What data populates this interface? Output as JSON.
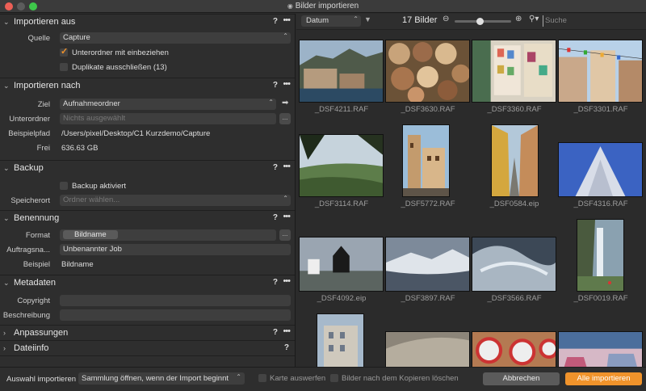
{
  "window": {
    "title": "Bilder importieren"
  },
  "sections": {
    "import_from": {
      "title": "Importieren aus",
      "source_label": "Quelle",
      "source_value": "Capture",
      "include_subfolders_label": "Unterordner mit einbeziehen",
      "include_subfolders_checked": true,
      "exclude_duplicates_label": "Duplikate ausschließen (13)",
      "exclude_duplicates_checked": false
    },
    "import_to": {
      "title": "Importieren nach",
      "target_label": "Ziel",
      "target_value": "Aufnahmeordner",
      "subfolder_label": "Unterordner",
      "subfolder_placeholder": "Nichts ausgewählt",
      "sample_path_label": "Beispielpfad",
      "sample_path_value": "/Users/pixel/Desktop/C1 Kurzdemo/Capture",
      "free_label": "Frei",
      "free_value": "636.63 GB"
    },
    "backup": {
      "title": "Backup",
      "backup_enabled_label": "Backup aktiviert",
      "location_label": "Speicherort",
      "location_placeholder": "Ordner wählen..."
    },
    "naming": {
      "title": "Benennung",
      "format_label": "Format",
      "format_token": "Bildname",
      "job_label": "Auftragsna...",
      "job_value": "Unbenannter Job",
      "example_label": "Beispiel",
      "example_value": "Bildname"
    },
    "metadata": {
      "title": "Metadaten",
      "copyright_label": "Copyright",
      "copyright_value": "",
      "description_label": "Beschreibung",
      "description_value": ""
    },
    "adjustments": {
      "title": "Anpassungen"
    },
    "file_info": {
      "title": "Dateiinfo"
    }
  },
  "common": {
    "help": "?",
    "more": "•••",
    "browse": "...",
    "chevron_down": "⌄",
    "chevron_right": "›"
  },
  "browser": {
    "sort_value": "Datum",
    "count_label": "17 Bilder",
    "search_placeholder": "Suche",
    "zoom_level": 0.45,
    "images": [
      "_DSF4211.RAF",
      "_DSF3630.RAF",
      "_DSF3360.RAF",
      "_DSF3301.RAF",
      "_DSF3114.RAF",
      "_DSF5772.RAF",
      "_DSF0584.eip",
      "_DSF4316.RAF",
      "_DSF4092.eip",
      "_DSF3897.RAF",
      "_DSF3566.RAF",
      "_DSF0019.RAF",
      "",
      "",
      "",
      ""
    ]
  },
  "footer": {
    "import_selection_label": "Auswahl importieren",
    "after_import_value": "Sammlung öffnen, wenn der Import beginnt",
    "show_map_label": "Karte auswerfen",
    "delete_after_copy_label": "Bilder nach dem Kopieren löschen",
    "cancel_label": "Abbrechen",
    "import_all_label": "Alle importieren"
  },
  "colors": {
    "accent": "#f0932b",
    "panel": "#2e2e2e",
    "field": "#3e3e3e"
  }
}
